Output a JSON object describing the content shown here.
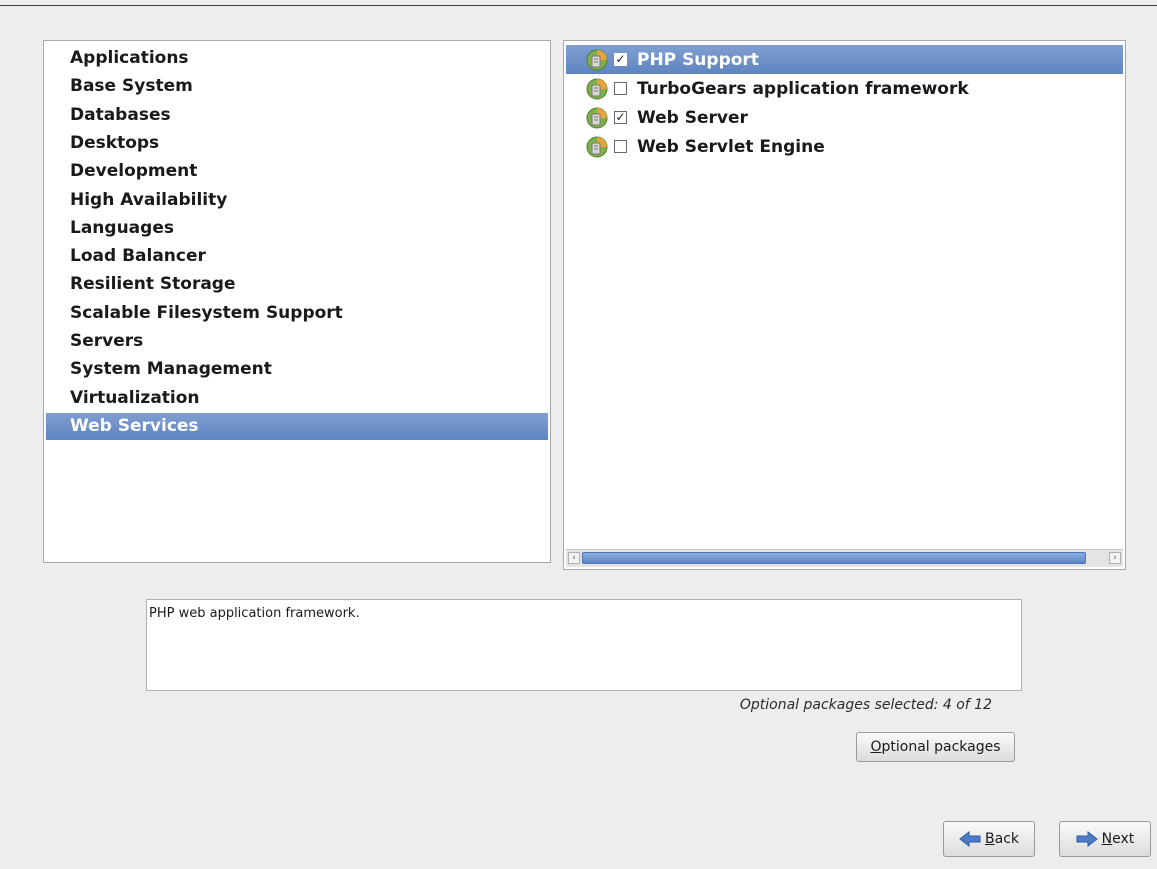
{
  "categories": [
    {
      "label": "Applications"
    },
    {
      "label": "Base System"
    },
    {
      "label": "Databases"
    },
    {
      "label": "Desktops"
    },
    {
      "label": "Development"
    },
    {
      "label": "High Availability"
    },
    {
      "label": "Languages"
    },
    {
      "label": "Load Balancer"
    },
    {
      "label": "Resilient Storage"
    },
    {
      "label": "Scalable Filesystem Support"
    },
    {
      "label": "Servers"
    },
    {
      "label": "System Management"
    },
    {
      "label": "Virtualization"
    },
    {
      "label": "Web Services",
      "selected": true
    }
  ],
  "groups": [
    {
      "label": "PHP Support",
      "checked": true,
      "selected": true,
      "icon": "package-icon"
    },
    {
      "label": "TurboGears application framework",
      "checked": false,
      "icon": "package-icon"
    },
    {
      "label": "Web Server",
      "checked": true,
      "icon": "package-icon"
    },
    {
      "label": "Web Servlet Engine",
      "checked": false,
      "icon": "package-icon"
    }
  ],
  "description": "PHP web application framework.",
  "optional_status": "Optional packages selected: 4 of 12",
  "buttons": {
    "optional_packages": {
      "mnemonic": "O",
      "rest": "ptional packages"
    },
    "back": {
      "mnemonic": "B",
      "rest": "ack"
    },
    "next": {
      "mnemonic": "N",
      "rest": "ext"
    }
  },
  "colors": {
    "selection": "#6a8dc8",
    "background": "#ededed"
  }
}
